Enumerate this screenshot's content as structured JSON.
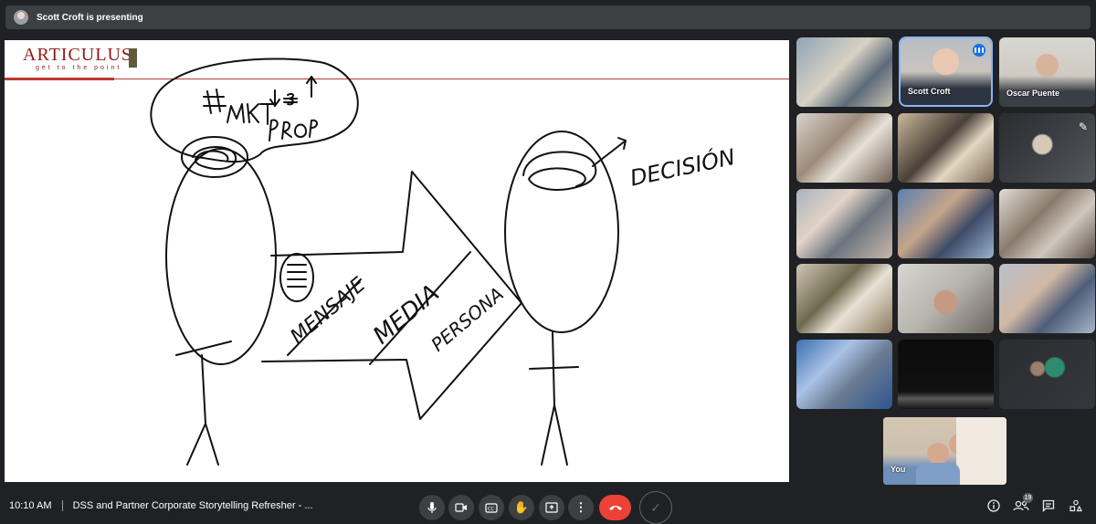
{
  "topbar": {
    "presenting": "Scott Croft is presenting"
  },
  "slide": {
    "logo_main": "ARTICULUS",
    "logo_sub": "get to the point"
  },
  "participants": [
    {
      "name": "",
      "speaking": false
    },
    {
      "name": "Scott Croft",
      "speaking": true
    },
    {
      "name": "Oscar Puente",
      "speaking": false
    },
    {
      "name": ""
    },
    {
      "name": ""
    },
    {
      "name": ""
    },
    {
      "name": ""
    },
    {
      "name": ""
    },
    {
      "name": ""
    },
    {
      "name": ""
    },
    {
      "name": ""
    },
    {
      "name": ""
    },
    {
      "name": ""
    },
    {
      "name": ""
    },
    {
      "name": ""
    }
  ],
  "self": {
    "label": "You"
  },
  "bottombar": {
    "time": "10:10 AM",
    "meeting_title": "DSS and Partner Corporate Storytelling Refresher - ...",
    "people_count": "19"
  },
  "icons": {
    "mic": "microphone-icon",
    "camera": "camera-icon",
    "captions": "captions-icon",
    "hand": "raise-hand-icon",
    "present": "present-screen-icon",
    "more": "more-options-icon",
    "end": "end-call-icon",
    "info": "info-icon",
    "people": "people-icon",
    "chat": "chat-icon",
    "activities": "activities-icon"
  },
  "colors": {
    "accent": "#8ab4f8",
    "end_call": "#ea4335",
    "logo": "#8f1a1a"
  }
}
